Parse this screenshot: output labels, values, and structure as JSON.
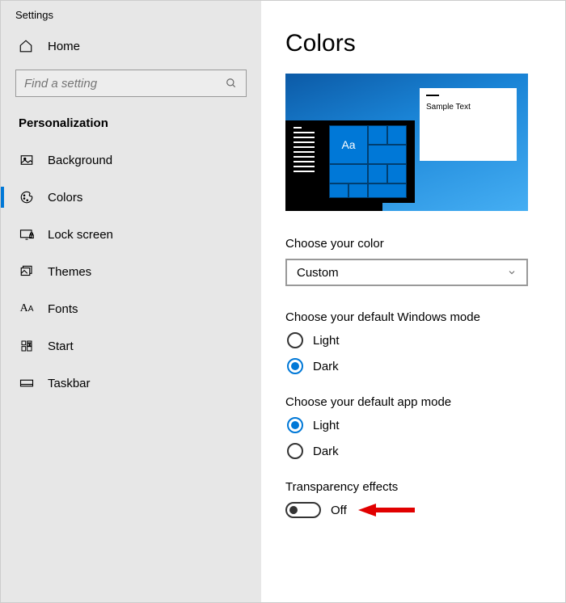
{
  "app_title": "Settings",
  "home_label": "Home",
  "search_placeholder": "Find a setting",
  "section": "Personalization",
  "nav": [
    {
      "label": "Background"
    },
    {
      "label": "Colors"
    },
    {
      "label": "Lock screen"
    },
    {
      "label": "Themes"
    },
    {
      "label": "Fonts"
    },
    {
      "label": "Start"
    },
    {
      "label": "Taskbar"
    }
  ],
  "page_title": "Colors",
  "preview": {
    "sample_text": "Sample Text",
    "tile_aa": "Aa"
  },
  "color_mode": {
    "label": "Choose your color",
    "value": "Custom"
  },
  "windows_mode": {
    "label": "Choose your default Windows mode",
    "options": {
      "light": "Light",
      "dark": "Dark"
    },
    "selected": "dark"
  },
  "app_mode": {
    "label": "Choose your default app mode",
    "options": {
      "light": "Light",
      "dark": "Dark"
    },
    "selected": "light"
  },
  "transparency": {
    "label": "Transparency effects",
    "state_text": "Off"
  }
}
